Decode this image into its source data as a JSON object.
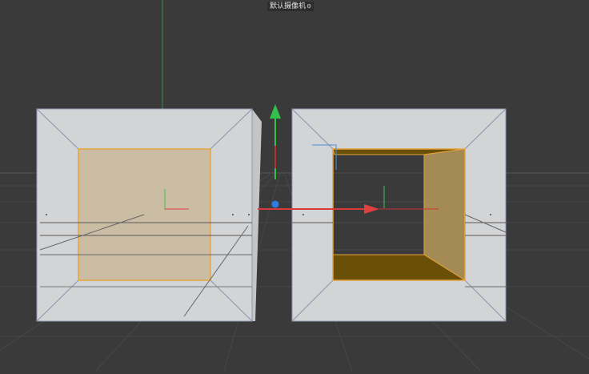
{
  "viewport": {
    "camera_label": "默认摄像机",
    "camera_icon": "camera-icon",
    "background_color": "#3a3a3a",
    "grid_color": "#4a4a4a",
    "object_face_color": "#d3d4d6",
    "selection_color": "#e8a33c",
    "selected_polygon_color": "#6a4f08",
    "axis_colors": {
      "x": "#e04040",
      "y": "#36c24a",
      "z": "#2f7de0"
    }
  }
}
